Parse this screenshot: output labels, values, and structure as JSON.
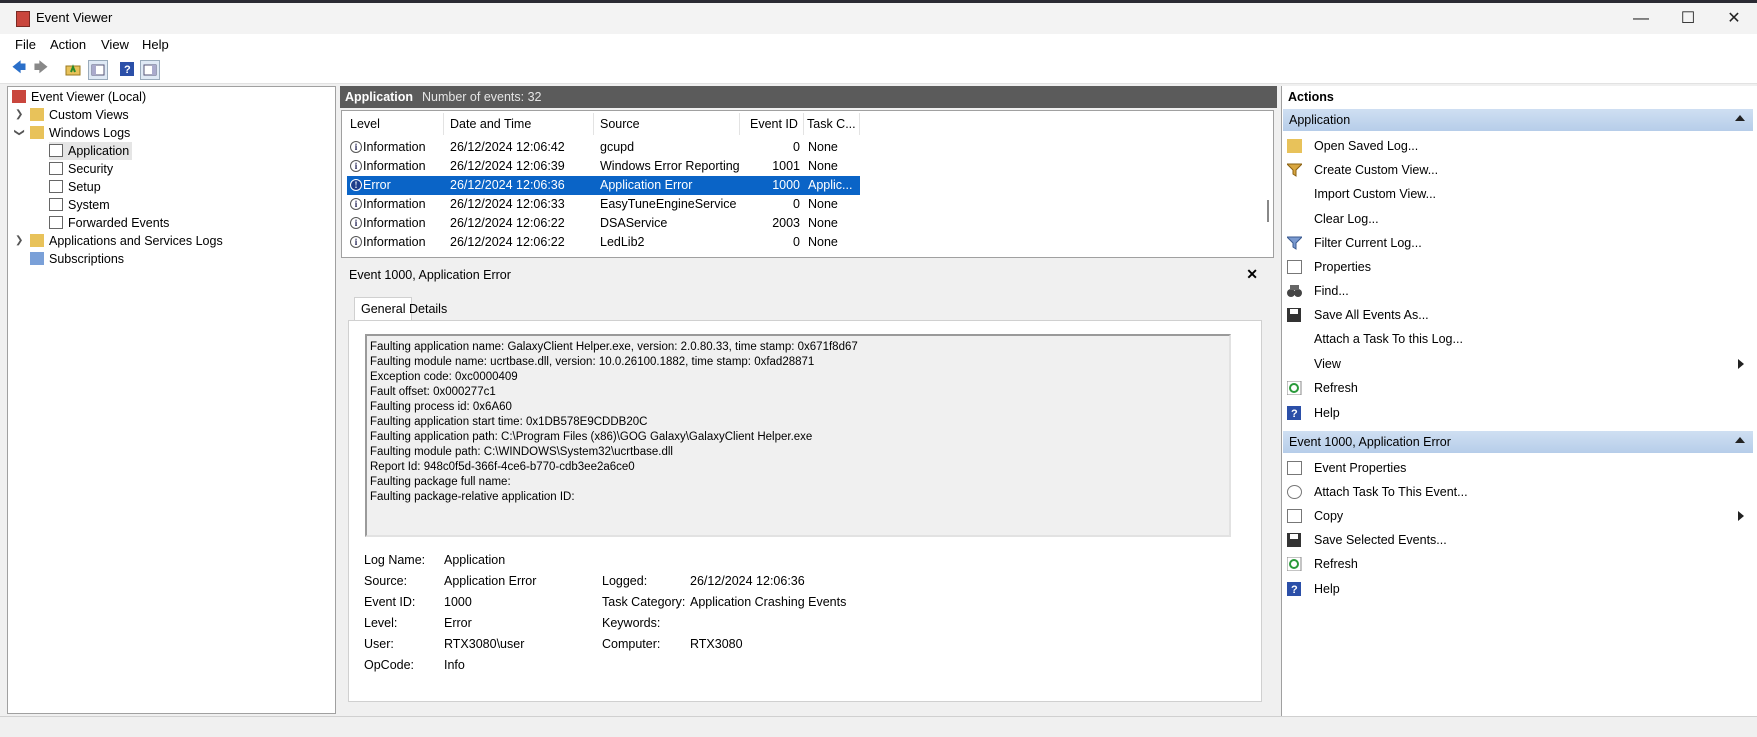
{
  "window": {
    "title": "Event Viewer"
  },
  "menu": [
    "File",
    "Action",
    "View",
    "Help"
  ],
  "tree": {
    "root": "Event Viewer (Local)",
    "custom_views": "Custom Views",
    "windows_logs": "Windows Logs",
    "logs": [
      "Application",
      "Security",
      "Setup",
      "System",
      "Forwarded Events"
    ],
    "apps_services": "Applications and Services Logs",
    "subscriptions": "Subscriptions"
  },
  "list_header": {
    "name": "Application",
    "count": "Number of events: 32"
  },
  "columns": [
    "Level",
    "Date and Time",
    "Source",
    "Event ID",
    "Task C..."
  ],
  "events": [
    {
      "level": "Information",
      "datetime": "26/12/2024 12:06:42",
      "source": "gcupd",
      "event_id": "0",
      "task": "None"
    },
    {
      "level": "Information",
      "datetime": "26/12/2024 12:06:39",
      "source": "Windows Error Reporting",
      "event_id": "1001",
      "task": "None"
    },
    {
      "level": "Error",
      "datetime": "26/12/2024 12:06:36",
      "source": "Application Error",
      "event_id": "1000",
      "task": "Applic..."
    },
    {
      "level": "Information",
      "datetime": "26/12/2024 12:06:33",
      "source": "EasyTuneEngineService",
      "event_id": "0",
      "task": "None"
    },
    {
      "level": "Information",
      "datetime": "26/12/2024 12:06:22",
      "source": "DSAService",
      "event_id": "2003",
      "task": "None"
    },
    {
      "level": "Information",
      "datetime": "26/12/2024 12:06:22",
      "source": "LedLib2",
      "event_id": "0",
      "task": "None"
    }
  ],
  "detail": {
    "title": "Event 1000, Application Error",
    "tabs": [
      "General",
      "Details"
    ],
    "description": [
      "Faulting application name: GalaxyClient Helper.exe, version: 2.0.80.33, time stamp: 0x671f8d67",
      "Faulting module name: ucrtbase.dll, version: 10.0.26100.1882, time stamp: 0xfad28871",
      "Exception code: 0xc0000409",
      "Fault offset: 0x000277c1",
      "Faulting process id: 0x6A60",
      "Faulting application start time: 0x1DB578E9CDDB20C",
      "Faulting application path: C:\\Program Files (x86)\\GOG Galaxy\\GalaxyClient Helper.exe",
      "Faulting module path: C:\\WINDOWS\\System32\\ucrtbase.dll",
      "Report Id: 948c0f5d-366f-4ce6-b770-cdb3ee2a6ce0",
      "Faulting package full name:",
      "Faulting package-relative application ID:"
    ],
    "fields": {
      "log_name_label": "Log Name:",
      "log_name": "Application",
      "source_label": "Source:",
      "source": "Application Error",
      "logged_label": "Logged:",
      "logged": "26/12/2024 12:06:36",
      "event_id_label": "Event ID:",
      "event_id": "1000",
      "task_category_label": "Task Category:",
      "task_category": "Application Crashing Events",
      "level_label": "Level:",
      "level": "Error",
      "keywords_label": "Keywords:",
      "keywords": "",
      "user_label": "User:",
      "user": "RTX3080\\user",
      "computer_label": "Computer:",
      "computer": "RTX3080",
      "opcode_label": "OpCode:",
      "opcode": "Info"
    }
  },
  "actions": {
    "title": "Actions",
    "section1": "Application",
    "section1_items": [
      "Open Saved Log...",
      "Create Custom View...",
      "Import Custom View...",
      "Clear Log...",
      "Filter Current Log...",
      "Properties",
      "Find...",
      "Save All Events As...",
      "Attach a Task To this Log...",
      "View",
      "Refresh",
      "Help"
    ],
    "section2": "Event 1000, Application Error",
    "section2_items": [
      "Event Properties",
      "Attach Task To This Event...",
      "Copy",
      "Save Selected Events...",
      "Refresh",
      "Help"
    ]
  },
  "colors": {
    "selection": "#0a64c7",
    "header_dark": "#5b5b5b",
    "section_header": "#c3d6ee"
  }
}
